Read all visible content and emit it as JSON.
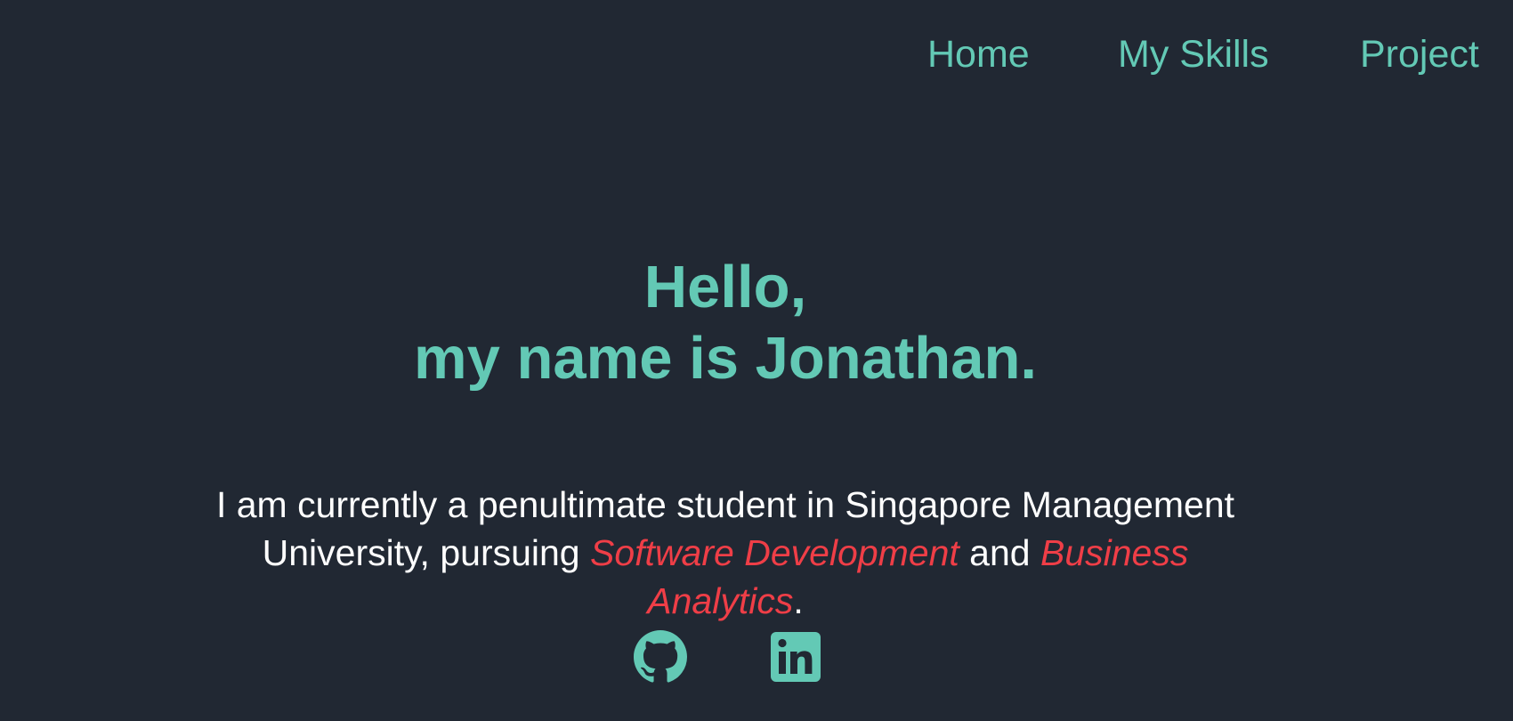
{
  "nav": {
    "home": "Home",
    "skills": "My Skills",
    "project": "Project"
  },
  "hero": {
    "line1": "Hello,",
    "line2": "my name is Jonathan."
  },
  "intro": {
    "part1": "I am currently a penultimate student in Singapore Management University, pursuing ",
    "highlight1": "Software Development",
    "part2": " and ",
    "highlight2": "Business Analytics",
    "part3": "."
  },
  "social": {
    "github_icon": "github-icon",
    "linkedin_icon": "linkedin-icon"
  },
  "colors": {
    "background": "#212833",
    "accent": "#63c9b5",
    "highlight": "#ef3e47",
    "text": "#ffffff"
  }
}
